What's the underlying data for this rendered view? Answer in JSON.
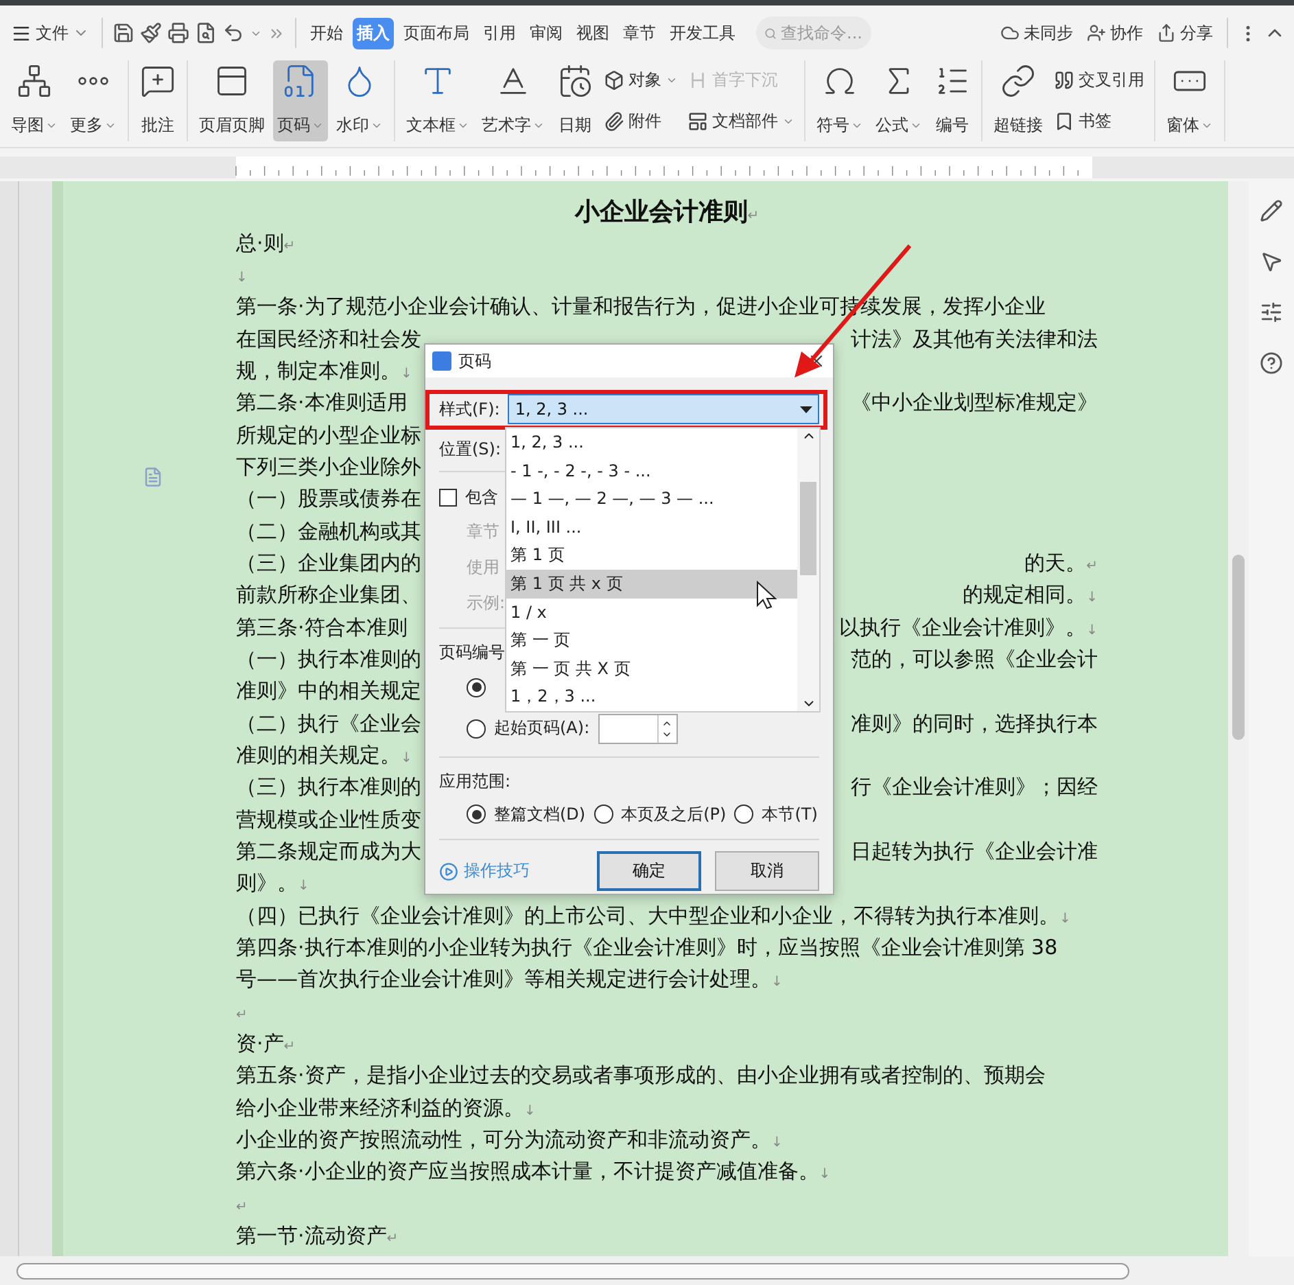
{
  "menu_bar": {
    "file_menu": "文件",
    "tabs": [
      {
        "label": "开始",
        "selected": false
      },
      {
        "label": "插入",
        "selected": true
      },
      {
        "label": "页面布局",
        "selected": false
      },
      {
        "label": "引用",
        "selected": false
      },
      {
        "label": "审阅",
        "selected": false
      },
      {
        "label": "视图",
        "selected": false
      },
      {
        "label": "章节",
        "selected": false
      },
      {
        "label": "开发工具",
        "selected": false
      }
    ],
    "search": {
      "placeholder": "查找命令..."
    },
    "actions": [
      "未同步",
      "协作",
      "分享"
    ]
  },
  "ribbon": {
    "groups": [
      {
        "items": [
          {
            "kind": "large",
            "label": "导图",
            "dropdown": true,
            "pressed": false
          },
          {
            "kind": "large",
            "label": "更多",
            "dropdown": true,
            "pressed": false
          }
        ]
      },
      {
        "items": [
          {
            "kind": "large",
            "label": "批注",
            "dropdown": false,
            "pressed": false
          }
        ]
      },
      {
        "items": [
          {
            "kind": "large",
            "label": "页眉页脚",
            "dropdown": false,
            "pressed": false
          },
          {
            "kind": "large",
            "label": "页码",
            "dropdown": true,
            "pressed": true
          },
          {
            "kind": "large",
            "label": "水印",
            "dropdown": true,
            "pressed": false
          }
        ]
      },
      {
        "items": [
          {
            "kind": "large",
            "label": "文本框",
            "dropdown": true,
            "pressed": false
          },
          {
            "kind": "large",
            "label": "艺术字",
            "dropdown": true,
            "pressed": false
          },
          {
            "kind": "large",
            "label": "日期",
            "dropdown": false,
            "pressed": false
          },
          {
            "kind": "stack",
            "rows": [
              {
                "label": "对象",
                "dropdown": true,
                "disabled": false
              },
              {
                "label": "附件",
                "dropdown": false,
                "disabled": false
              }
            ]
          },
          {
            "kind": "stack",
            "rows": [
              {
                "label": "首字下沉",
                "dropdown": false,
                "disabled": true
              },
              {
                "label": "文档部件",
                "dropdown": true,
                "disabled": false
              }
            ]
          }
        ]
      },
      {
        "items": [
          {
            "kind": "large",
            "label": "符号",
            "dropdown": true,
            "pressed": false
          },
          {
            "kind": "large",
            "label": "公式",
            "dropdown": true,
            "pressed": false
          },
          {
            "kind": "large",
            "label": "编号",
            "dropdown": false,
            "pressed": false
          }
        ]
      },
      {
        "items": [
          {
            "kind": "large",
            "label": "超链接",
            "dropdown": false,
            "pressed": false
          },
          {
            "kind": "stack",
            "rows": [
              {
                "label": "交叉引用",
                "dropdown": false,
                "disabled": false
              },
              {
                "label": "书签",
                "dropdown": false,
                "disabled": false
              }
            ]
          }
        ]
      },
      {
        "items": [
          {
            "kind": "large",
            "label": "窗体",
            "dropdown": true,
            "pressed": false
          }
        ]
      }
    ]
  },
  "document": {
    "lines": [
      {
        "kind": "title",
        "text": "小企业会计准则",
        "end": "↵"
      },
      {
        "kind": "line",
        "text": "总·则",
        "end": "↵"
      },
      {
        "kind": "line",
        "end": "↓"
      },
      {
        "kind": "line",
        "text": "第一条·为了规范小企业会计确认、计量和报告行为，促进小企业可持续发展，发挥小企业"
      },
      {
        "kind": "split",
        "left": {
          "text": "在国民经济和社会发"
        },
        "right": {
          "text": "计法》及其他有关法律和法"
        }
      },
      {
        "kind": "split",
        "left": {
          "text": "规，制定本准则。",
          "end": "↓"
        }
      },
      {
        "kind": "split",
        "left": {
          "text": "第二条·本准则适用"
        },
        "right": {
          "text": "《中小企业划型标准规定》"
        }
      },
      {
        "kind": "split",
        "left": {
          "text": "所规定的小型企业标"
        }
      },
      {
        "kind": "split",
        "left": {
          "text": "下列三类小企业除外"
        }
      },
      {
        "kind": "split",
        "left": {
          "text": "（一）股票或债券在"
        }
      },
      {
        "kind": "split",
        "left": {
          "text": "（二）金融机构或其"
        }
      },
      {
        "kind": "split",
        "left": {
          "text": "（三）企业集团内的"
        },
        "right": {
          "text": "的天。",
          "end": "↵"
        }
      },
      {
        "kind": "split",
        "left": {
          "text": "前款所称企业集团、"
        },
        "right": {
          "text": "的规定相同。",
          "end": "↓"
        }
      },
      {
        "kind": "split",
        "left": {
          "text": "第三条·符合本准则"
        },
        "right": {
          "text": "以执行《企业会计准则》。",
          "end": "↓"
        }
      },
      {
        "kind": "split",
        "left": {
          "text": "（一）执行本准则的"
        },
        "right": {
          "text": "范的，可以参照《企业会计"
        }
      },
      {
        "kind": "split",
        "left": {
          "text": "准则》中的相关规定"
        }
      },
      {
        "kind": "split",
        "left": {
          "text": "（二）执行《企业会"
        },
        "right": {
          "text": "准则》的同时，选择执行本"
        }
      },
      {
        "kind": "split",
        "left": {
          "text": "准则的相关规定。",
          "end": "↓"
        }
      },
      {
        "kind": "split",
        "left": {
          "text": "（三）执行本准则的"
        },
        "right": {
          "text": "行《企业会计准则》；因经"
        }
      },
      {
        "kind": "split",
        "left": {
          "text": "营规模或企业性质变"
        }
      },
      {
        "kind": "split",
        "left": {
          "text": "第二条规定而成为大"
        },
        "right": {
          "text": "日起转为执行《企业会计准"
        }
      },
      {
        "kind": "line",
        "text": "则》。",
        "end": "↓"
      },
      {
        "kind": "line",
        "text": "（四）已执行《企业会计准则》的上市公司、大中型企业和小企业，不得转为执行本准则。",
        "end": "↓"
      },
      {
        "kind": "line",
        "text": "第四条·执行本准则的小企业转为执行《企业会计准则》时，应当按照《企业会计准则第 38"
      },
      {
        "kind": "line",
        "text": "号——首次执行企业会计准则》等相关规定进行会计处理。",
        "end": "↓"
      },
      {
        "kind": "line",
        "end": "↵"
      },
      {
        "kind": "line",
        "text": "资·产",
        "end": "↵"
      },
      {
        "kind": "line",
        "text": "第五条·资产，是指小企业过去的交易或者事项形成的、由小企业拥有或者控制的、预期会"
      },
      {
        "kind": "line",
        "text": "给小企业带来经济利益的资源。",
        "end": "↓"
      },
      {
        "kind": "line",
        "text": "小企业的资产按照流动性，可分为流动资产和非流动资产。",
        "end": "↓"
      },
      {
        "kind": "line",
        "text": "第六条·小企业的资产应当按照成本计量，不计提资产减值准备。",
        "end": "↓"
      },
      {
        "kind": "line",
        "end": "↵"
      },
      {
        "kind": "line",
        "text": "第一节·流动资产",
        "end": "↵"
      }
    ]
  },
  "dialog": {
    "title": "页码",
    "style": {
      "label": "样式(F):",
      "value": "1, 2, 3 ...",
      "options": [
        {
          "label": "1, 2, 3 ...",
          "hovered": false
        },
        {
          "label": "- 1 -, - 2 -, - 3 - ...",
          "hovered": false
        },
        {
          "label": "— 1 —, — 2 —, — 3 — ...",
          "hovered": false
        },
        {
          "label": "I, II, III ...",
          "hovered": false
        },
        {
          "label": "第 1 页",
          "hovered": false
        },
        {
          "label": "第 1 页 共 x 页",
          "hovered": true
        },
        {
          "label": "1 / x",
          "hovered": false
        },
        {
          "label": "第 一 页",
          "hovered": false
        },
        {
          "label": "第 一 页 共 X 页",
          "hovered": false
        },
        {
          "label": "1，2，3 ...",
          "hovered": false
        }
      ]
    },
    "position": {
      "label": "位置(S):"
    },
    "include_chapter": {
      "label": "包含",
      "checked": false
    },
    "disabled_labels": [
      "章节",
      "使用",
      "示例:"
    ],
    "numbering": {
      "label": "页码编号",
      "options": [
        {
          "selected": true
        },
        {
          "label": "起始页码(A):",
          "selected": false
        }
      ]
    },
    "scope": {
      "label": "应用范围:",
      "options": [
        {
          "label": "整篇文档(D)",
          "selected": true
        },
        {
          "label": "本页及之后(P)",
          "selected": false
        },
        {
          "label": "本节(T)",
          "selected": false
        }
      ]
    },
    "tips_link": "操作技巧",
    "buttons": [
      {
        "label": "确定",
        "default": true
      },
      {
        "label": "取消",
        "default": false
      }
    ]
  }
}
